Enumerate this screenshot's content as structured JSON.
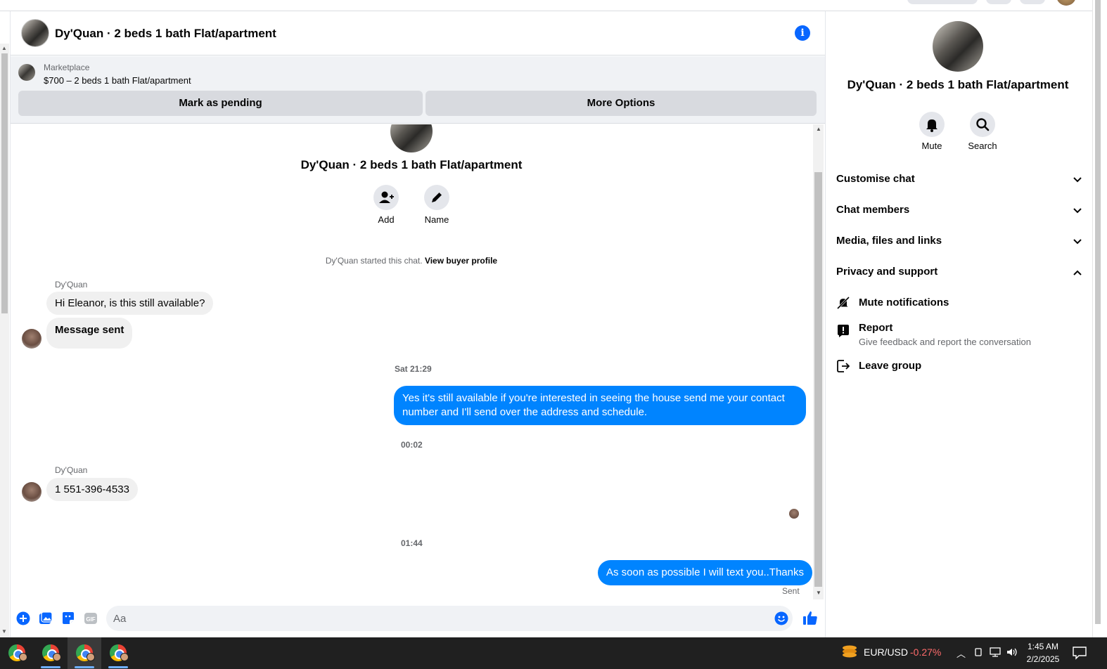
{
  "chat": {
    "title": "Dy'Quan · 2 beds 1 bath Flat/apartment",
    "marketplace_label": "Marketplace",
    "listing": "$700 – 2 beds 1 bath Flat/apartment",
    "mark_pending": "Mark as pending",
    "more_options": "More Options",
    "room_name": "Dy'Quan · 2 beds 1 bath Flat/apartment",
    "add_label": "Add",
    "name_label": "Name",
    "started_text": "Dy'Quan started this chat.",
    "view_buyer_profile": "View buyer profile",
    "messages": [
      {
        "sender": "Dy'Quan",
        "text": "Hi Eleanor, is this still available?"
      },
      {
        "text": "Message sent"
      },
      {
        "timestamp": "Sat 21:29"
      },
      {
        "text": "Yes it's still available if you're interested in seeing the house send me your contact number and I'll send over the address and schedule."
      },
      {
        "timestamp": "00:02"
      },
      {
        "sender": "Dy'Quan",
        "text": "1 551-396-4533"
      },
      {
        "timestamp": "01:44"
      },
      {
        "text": "As soon as possible I will text you..Thanks",
        "status": "Sent"
      }
    ],
    "composer_placeholder": "Aa"
  },
  "side": {
    "title": "Dy'Quan · 2 beds 1 bath Flat/apartment",
    "mute": "Mute",
    "search": "Search",
    "sections": [
      "Customise chat",
      "Chat members",
      "Media, files and links",
      "Privacy and support"
    ],
    "options": {
      "mute_notifications": "Mute notifications",
      "report": "Report",
      "report_sub": "Give feedback and report the conversation",
      "leave_group": "Leave group"
    }
  },
  "taskbar": {
    "ticker": "EUR/USD",
    "ticker_change": "-0.27%",
    "time": "1:45 AM",
    "date": "2/2/2025"
  },
  "colors": {
    "accent": "#0084ff",
    "brand_blue": "#0866ff",
    "negative": "#ff6b6b"
  }
}
